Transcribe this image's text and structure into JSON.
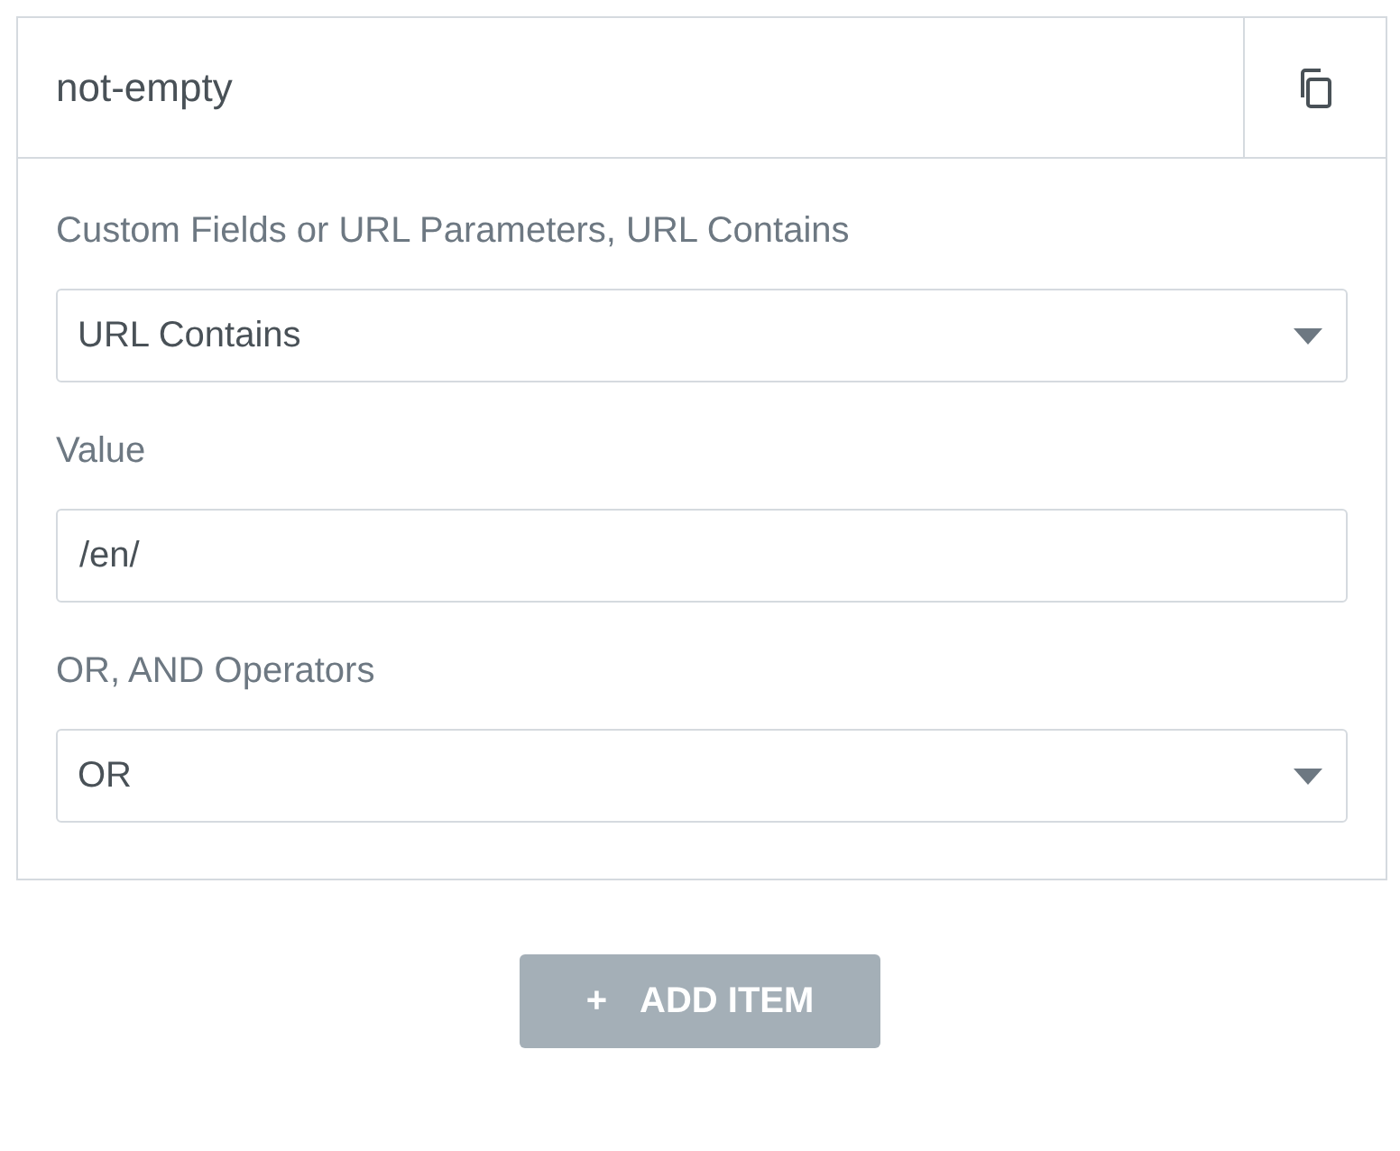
{
  "panel": {
    "title": "not-empty",
    "fields": [
      {
        "kind": "select",
        "label": "Custom Fields or URL Parameters, URL Contains",
        "value": "URL Contains"
      },
      {
        "kind": "text",
        "label": "Value",
        "value": "/en/"
      },
      {
        "kind": "select",
        "label": "OR, AND Operators",
        "value": "OR"
      }
    ]
  },
  "add_button": {
    "icon": "+",
    "label": "ADD ITEM"
  }
}
